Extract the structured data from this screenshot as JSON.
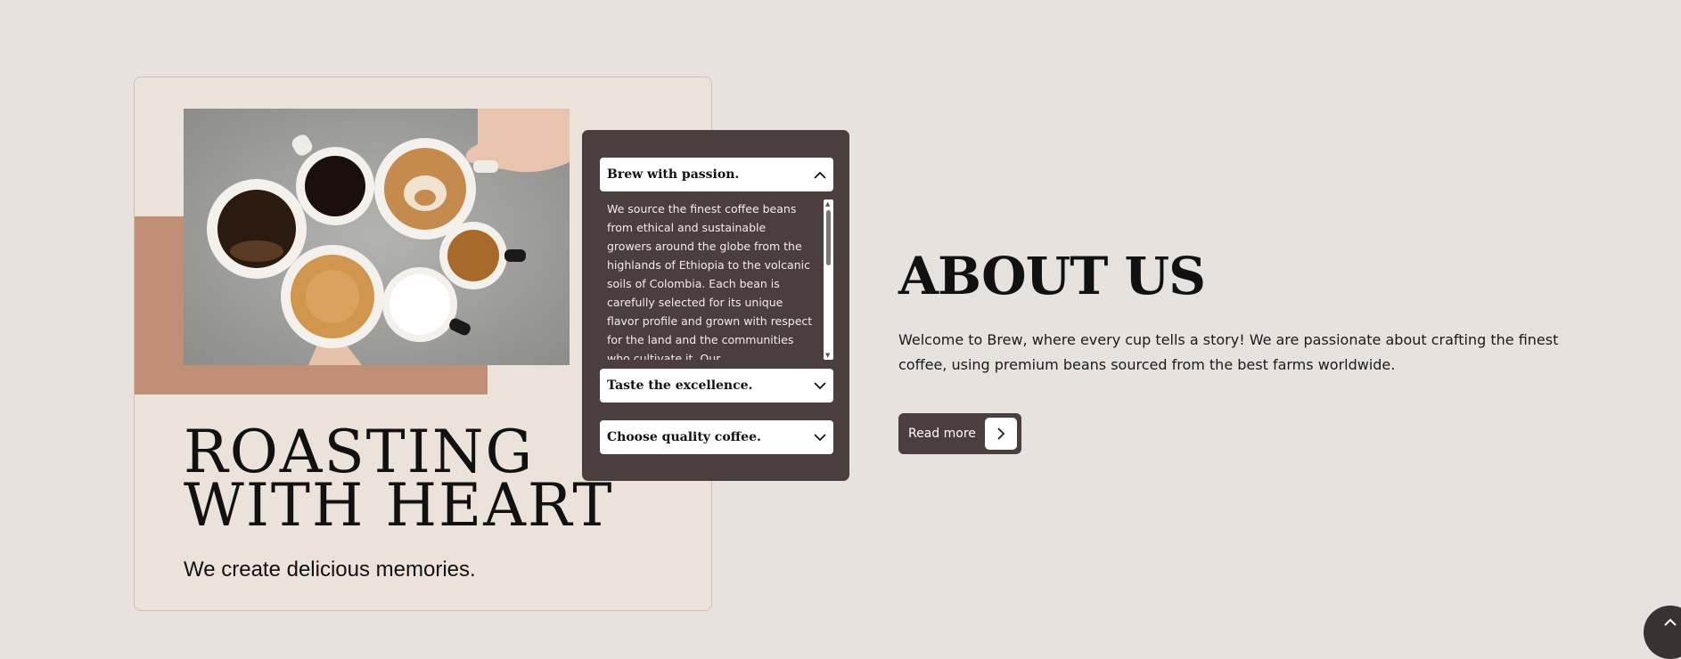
{
  "hero": {
    "title": "ROASTING\nWITH HEART",
    "subtitle": "We create delicious memories."
  },
  "accordion": {
    "items": [
      {
        "title": "Brew with passion.",
        "expanded": true,
        "icon": "chevron-up-icon",
        "body": "We source the finest coffee beans from ethical and sustainable growers around the globe from the highlands of Ethiopia to the volcanic soils of Colombia. Each bean is carefully selected for its unique flavor profile and grown with respect for the land and the communities who cultivate it. Our"
      },
      {
        "title": "Taste the excellence.",
        "expanded": false,
        "icon": "chevron-down-icon"
      },
      {
        "title": "Choose quality coffee.",
        "expanded": false,
        "icon": "chevron-down-icon"
      }
    ]
  },
  "about": {
    "title": "ABOUT US",
    "text": "Welcome to Brew, where every cup tells a story! We are passionate about crafting the finest coffee, using premium beans sourced from the best farms worldwide.",
    "button_label": "Read more",
    "button_icon": "chevron-right-icon"
  },
  "colors": {
    "background": "#e8e2df",
    "card": "#ebe3da",
    "accent": "#c18f76",
    "dark": "#4a3e3e"
  }
}
